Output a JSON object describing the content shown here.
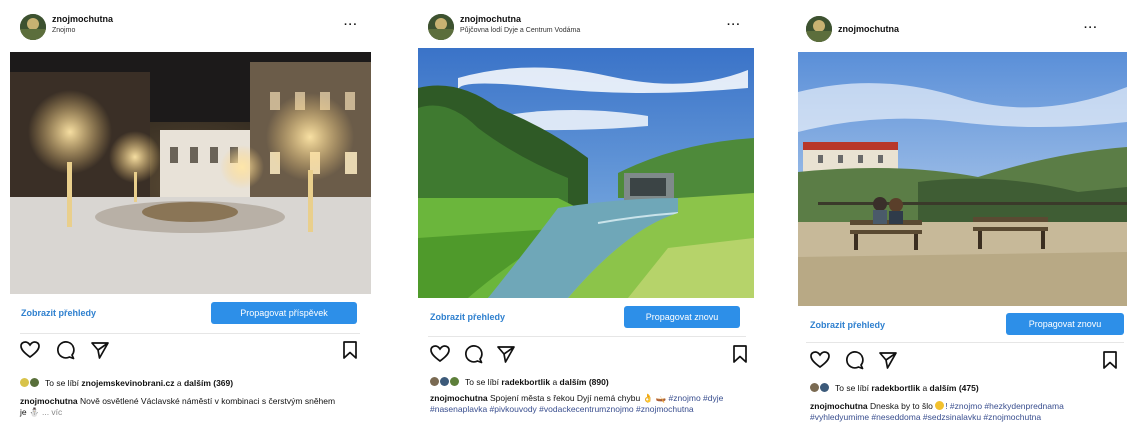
{
  "posts": [
    {
      "username": "znojmochutna",
      "location": "Znojmo",
      "insights_label": "Zobrazit přehledy",
      "promote_label": "Propagovat příspěvek",
      "likes_prefix": "To se líbí",
      "likes_user": "znojemskevinobrani.cz",
      "likes_connector": "a",
      "likes_more": "dalším (369)",
      "caption_user": "znojmochutna",
      "caption_text": "Nově osvětlené Václavské náměstí v kombinaci s čerstvým sněhem je",
      "caption_more": "... víc"
    },
    {
      "username": "znojmochutna",
      "location": "Půjčovna lodí Dyje a Centrum Vodáma",
      "insights_label": "Zobrazit přehledy",
      "promote_label": "Propagovat znovu",
      "likes_prefix": "To se líbí",
      "likes_user": "radekbortlik",
      "likes_connector": "a",
      "likes_more": "dalším (890)",
      "caption_user": "znojmochutna",
      "caption_text": "Spojení města s řekou Dyjí nemá chybu",
      "caption_tags": "#znojmo #dyje #nasenaplavka #pivkouvody #vodackecentrumznojmo #znojmochutna"
    },
    {
      "username": "znojmochutna",
      "location": "",
      "insights_label": "Zobrazit přehledy",
      "promote_label": "Propagovat znovu",
      "likes_prefix": "To se líbí",
      "likes_user": "radekbortlik",
      "likes_connector": "a",
      "likes_more": "dalším (475)",
      "caption_user": "znojmochutna",
      "caption_text": "Dneska by to šlo",
      "caption_tags": "! #znojmo #hezkydenprednama #vyhledyumime #neseddoma #sedzsinalavku #znojmochutna"
    }
  ],
  "icons": {
    "more": "more-options-icon",
    "like": "heart-icon",
    "comment": "comment-icon",
    "share": "share-icon",
    "save": "bookmark-icon"
  },
  "more_glyph": "···",
  "colors": {
    "accent": "#2d8fe8",
    "link": "#2f80cf",
    "hashtag": "#3a4f8f"
  }
}
